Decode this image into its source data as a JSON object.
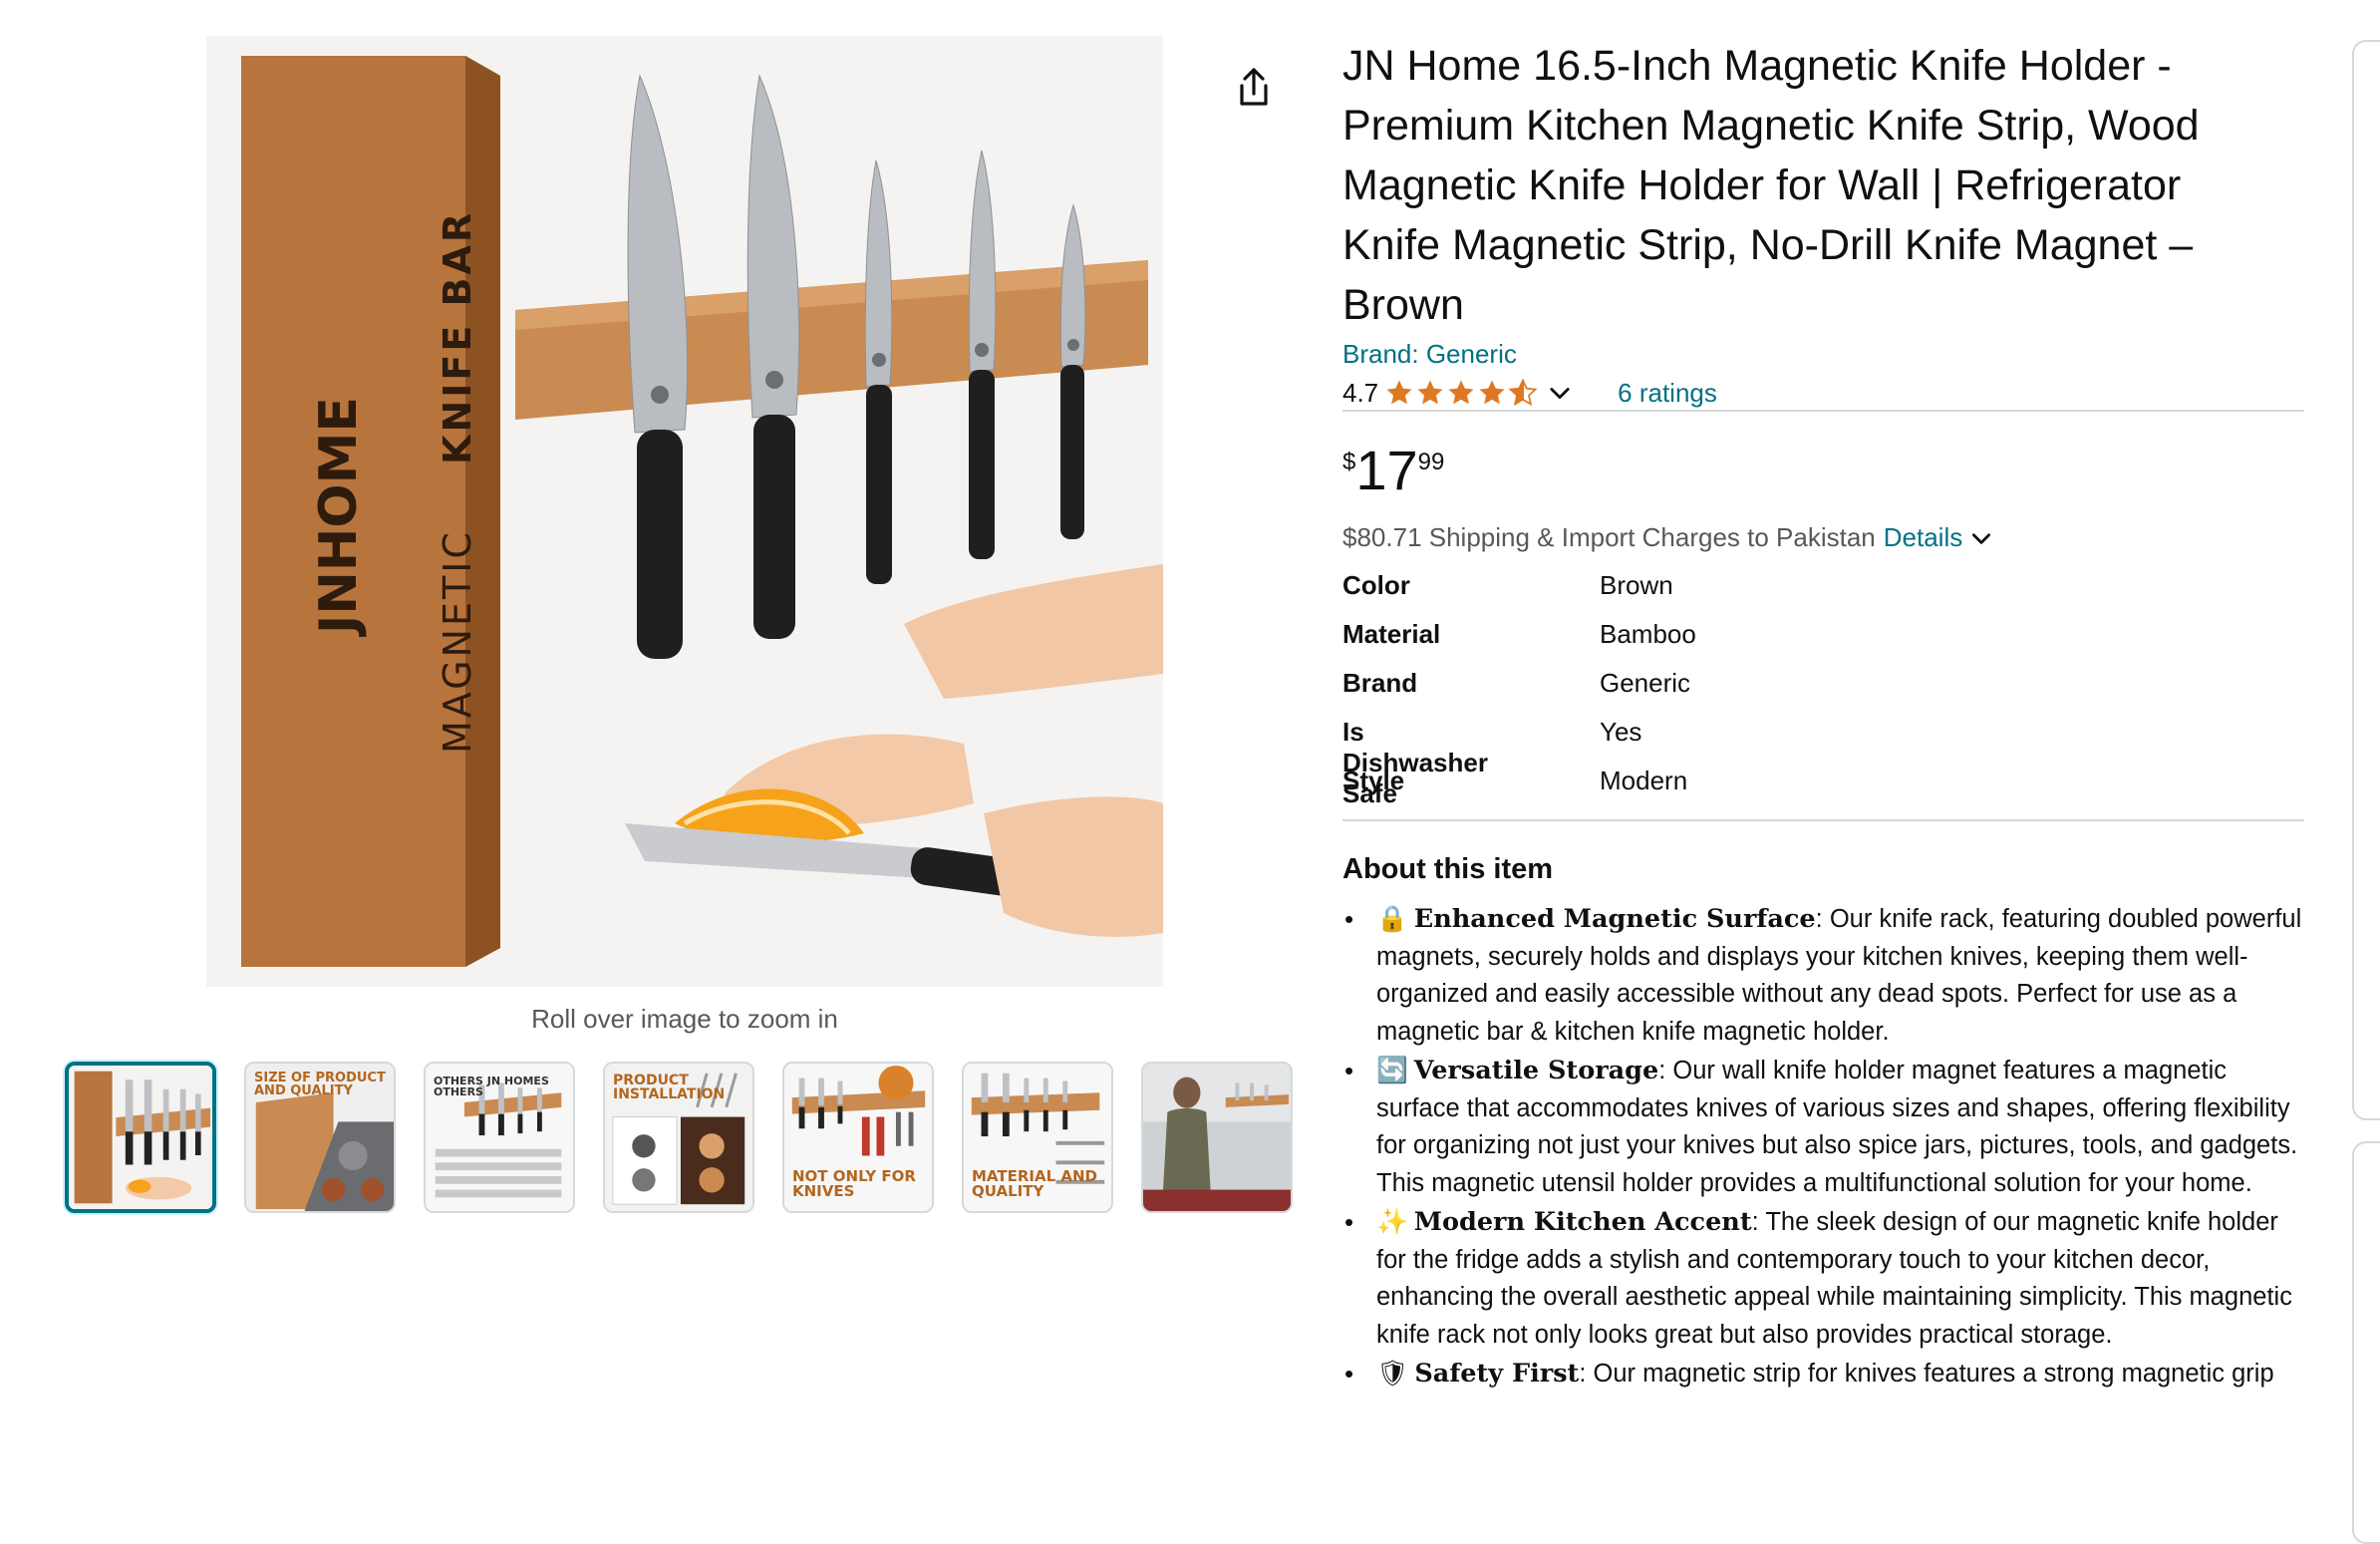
{
  "image": {
    "zoom_hint": "Roll over image to zoom in",
    "box_brand": "JNHOME",
    "box_text_light": "MAGNETIC",
    "box_text_bold": "KNIFE BAR"
  },
  "thumbnails": [
    {
      "caption": "",
      "active": true
    },
    {
      "caption": "SIZE OF PRODUCT AND QUALITY",
      "active": false
    },
    {
      "caption": "OTHERS  JN HOMES  OTHERS",
      "active": false
    },
    {
      "caption": "PRODUCT INSTALLATION",
      "active": false
    },
    {
      "caption": "NOT ONLY FOR KNIVES",
      "active": false
    },
    {
      "caption": "MATERIAL AND QUALITY",
      "active": false
    },
    {
      "caption": "",
      "active": false
    }
  ],
  "product": {
    "title": "JN Home 16.5-Inch Magnetic Knife Holder - Premium Kitchen Magnetic Knife Strip, Wood Magnetic Knife Holder for Wall | Refrigerator Knife Magnetic Strip, No-Drill Knife Magnet – Brown",
    "brand_link": "Brand: Generic",
    "rating_value": "4.7",
    "rating_fraction": 0.94,
    "ratings_count": "6 ratings",
    "price_symbol": "$",
    "price_whole": "17",
    "price_fraction": "99",
    "shipping_text": "$80.71 Shipping & Import Charges to Pakistan",
    "shipping_details": "Details",
    "star_color": "#de7921"
  },
  "specs": [
    {
      "key": "Color",
      "value": "Brown"
    },
    {
      "key": "Material",
      "value": "Bamboo"
    },
    {
      "key": "Brand",
      "value": "Generic"
    },
    {
      "key": "Is Dishwasher Safe",
      "value": "Yes"
    },
    {
      "key": "Style",
      "value": "Modern"
    }
  ],
  "about": {
    "heading": "About this item",
    "bullets": [
      {
        "emoji": "🔒",
        "title": "Enhanced Magnetic Surface",
        "text": ": Our knife rack, featuring doubled powerful magnets, securely holds and displays your kitchen knives, keeping them well-organized and easily accessible without any dead spots. Perfect for use as a magnetic bar & kitchen knife magnetic holder."
      },
      {
        "emoji": "🔄",
        "title": "Versatile Storage",
        "text": ": Our wall knife holder magnet features a magnetic surface that accommodates knives of various sizes and shapes, offering flexibility for organizing not just your knives but also spice jars, pictures, tools, and gadgets. This magnetic utensil holder provides a multifunctional solution for your home."
      },
      {
        "emoji": "✨",
        "title": "Modern Kitchen Accent",
        "text": ": The sleek design of our magnetic knife holder for the fridge adds a stylish and contemporary touch to your kitchen decor, enhancing the overall aesthetic appeal while maintaining simplicity. This magnetic knife rack not only looks great but also provides practical storage."
      },
      {
        "emoji": "🛡",
        "title": "Safety First",
        "text": ": Our magnetic strip for knives features a strong magnetic grip"
      }
    ]
  },
  "icons": {
    "share": "share-icon",
    "star": "star-icon",
    "chevron": "chevron-down-icon"
  },
  "colors": {
    "link": "#007185",
    "active_thumb_border": "#007185",
    "box": "#b8743d",
    "strip": "#c98b52"
  }
}
